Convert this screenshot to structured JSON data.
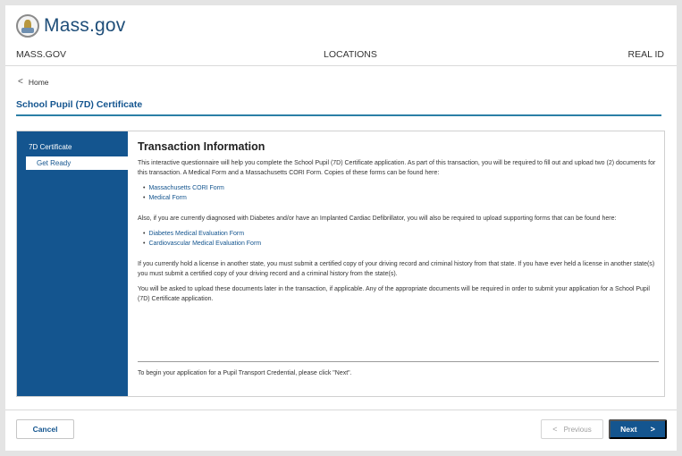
{
  "header": {
    "logo_text": "Mass.gov",
    "nav": {
      "mass": "MASS.GOV",
      "locations": "LOCATIONS",
      "real_id": "REAL ID"
    }
  },
  "breadcrumb": {
    "chevron": "<",
    "home": "Home"
  },
  "page": {
    "title": "School Pupil (7D) Certificate"
  },
  "sidebar": {
    "heading": "7D Certificate",
    "items": [
      {
        "label": "Get Ready",
        "selected": true
      }
    ]
  },
  "content": {
    "heading": "Transaction Information",
    "intro": "This interactive questionnaire will help you complete the School Pupil (7D) Certificate application. As part of this transaction, you will be required to fill out and upload two (2) documents for this transaction. A Medical Form and a Massachusetts CORI Form. Copies of these forms can be found here:",
    "links1": [
      "Massachusetts CORI Form",
      "Medical Form"
    ],
    "diabetes_text": "Also, if you are currently diagnosed with Diabetes and/or have an Implanted Cardiac Defibrillator, you will also be required to upload supporting forms that can be found here:",
    "links2": [
      "Diabetes Medical Evaluation Form",
      "Cardiovascular Medical Evaluation Form"
    ],
    "license_text": "If you currently hold a license in another state, you must submit a certified copy of your driving record and criminal history from that state. If you have ever held a license in another state(s) you must submit a certified copy of your driving record and a criminal history from the state(s).",
    "upload_text": "You will be asked to upload these documents later in the transaction, if applicable. Any of the appropriate documents will be required in order to submit your application for a School Pupil (7D) Certificate application.",
    "begin_text": "To begin your application for a Pupil Transport Credential, please click \"Next\"."
  },
  "footer": {
    "cancel_label": "Cancel",
    "prev_chevron": "<",
    "prev_label": "Previous",
    "next_label": "Next",
    "next_chevron": ">"
  },
  "colors": {
    "brand_blue": "#14558f",
    "accent_line": "#2b7fa6",
    "logo_blue": "#1f4e79"
  }
}
